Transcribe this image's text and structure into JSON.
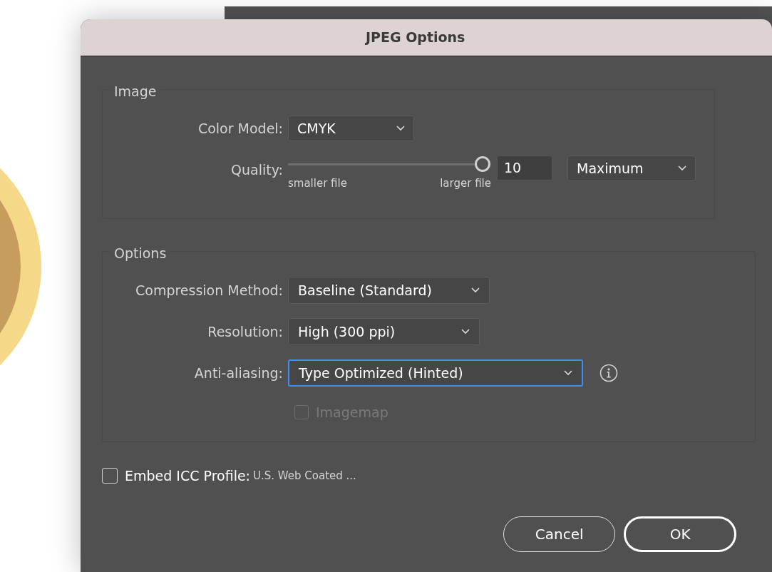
{
  "dialog": {
    "title": "JPEG Options"
  },
  "image_group": {
    "legend": "Image",
    "color_model": {
      "label": "Color Model:",
      "value": "CMYK"
    },
    "quality": {
      "label": "Quality:",
      "level": 1,
      "value": "10",
      "preset": "Maximum",
      "min_label": "smaller file",
      "max_label": "larger file"
    }
  },
  "options_group": {
    "legend": "Options",
    "fields": [
      {
        "label": "Compression Method:",
        "value": "Baseline (Standard)",
        "focused": false
      },
      {
        "label": "Resolution:",
        "value": "High (300 ppi)",
        "focused": false
      },
      {
        "label": "Anti-aliasing:",
        "value": "Type Optimized (Hinted)",
        "focused": true
      }
    ],
    "imagemap": {
      "label": "Imagemap",
      "checked": false,
      "disabled": true
    }
  },
  "embed_icc": {
    "label": "Embed ICC Profile:",
    "value": "U.S. Web Coated ...",
    "checked": false
  },
  "buttons": [
    {
      "label": "Cancel",
      "default": false
    },
    {
      "label": "OK",
      "default": true
    }
  ]
}
